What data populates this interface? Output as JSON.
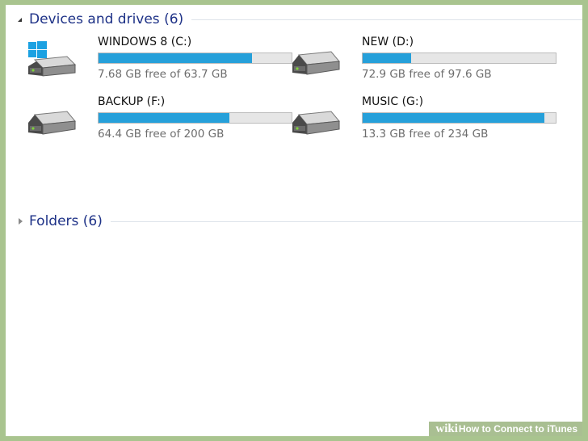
{
  "groups": {
    "devices": {
      "title": "Devices and drives (6)",
      "expanded": true
    },
    "folders": {
      "title": "Folders (6)",
      "expanded": false
    }
  },
  "drives": [
    {
      "name": "WINDOWS 8 (C:)",
      "free_text": "7.68 GB free of 63.7 GB",
      "used_fraction": 0.795,
      "system": true
    },
    {
      "name": "NEW (D:)",
      "free_text": "72.9 GB free of 97.6 GB",
      "used_fraction": 0.253,
      "system": false
    },
    {
      "name": "BACKUP (F:)",
      "free_text": "64.4 GB free of 200 GB",
      "used_fraction": 0.678,
      "system": false
    },
    {
      "name": "MUSIC (G:)",
      "free_text": "13.3 GB free of 234 GB",
      "used_fraction": 0.943,
      "system": false
    }
  ],
  "watermark": {
    "wiki": "wiki",
    "text": "How to Connect to iTunes"
  },
  "colors": {
    "bar_fill": "#26a0da",
    "bar_track": "#e6e6e6",
    "group_title": "#1e3287",
    "windows_logo": "#1ba1e2"
  }
}
